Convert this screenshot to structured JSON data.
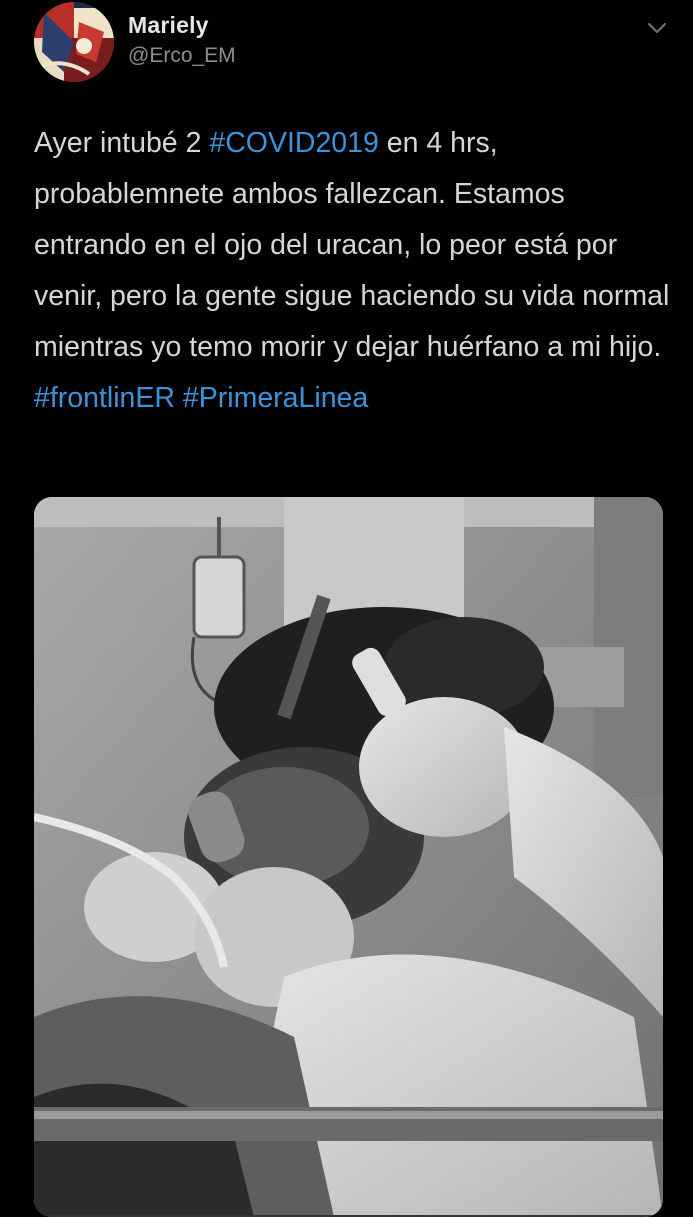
{
  "tweet": {
    "author_name": "Mariely",
    "author_handle": "@Erco_EM",
    "text": {
      "p1": "Ayer intubé 2 ",
      "tag1": "#COVID2019",
      "p2": " en 4 hrs, probablemnete ambos fallezcan.  Estamos entrando en el ojo del uracan, lo peor está por venir, pero la gente sigue haciendo su vida normal mientras yo temo morir y dejar huérfano a mi hijo. ",
      "tag2": "#frontlinER",
      "tag3": "#PrimeraLinea"
    },
    "icons": {
      "menu": "chevron-down-icon",
      "avatar": "avatar-image",
      "media": "photo-intubation-grayscale"
    },
    "colors": {
      "background": "#000000",
      "text": "#d6d6d6",
      "hashtag": "#3b94d9",
      "handle": "#8a8f94"
    }
  }
}
